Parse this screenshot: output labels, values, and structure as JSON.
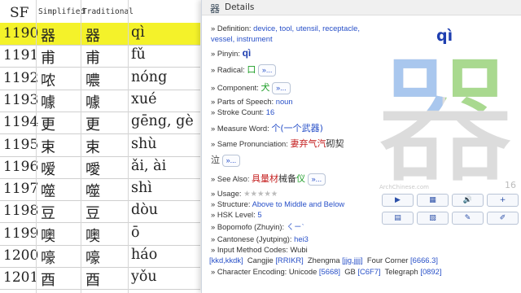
{
  "table": {
    "headers": {
      "sf": "SF",
      "simplified": "Simplified",
      "traditional": "Traditional"
    },
    "rows": [
      {
        "num": "1190",
        "simp": "器",
        "trad": "器",
        "pinyin": "qì"
      },
      {
        "num": "1191",
        "simp": "甫",
        "trad": "甫",
        "pinyin": "fǔ"
      },
      {
        "num": "1192",
        "simp": "哝",
        "trad": "噥",
        "pinyin": "nóng"
      },
      {
        "num": "1193",
        "simp": "噱",
        "trad": "噱",
        "pinyin": "xué"
      },
      {
        "num": "1194",
        "simp": "更",
        "trad": "更",
        "pinyin": "gēng, gè"
      },
      {
        "num": "1195",
        "simp": "束",
        "trad": "束",
        "pinyin": "shù"
      },
      {
        "num": "1196",
        "simp": "嗳",
        "trad": "噯",
        "pinyin": "ǎi, ài"
      },
      {
        "num": "1197",
        "simp": "噬",
        "trad": "噬",
        "pinyin": "shì"
      },
      {
        "num": "1198",
        "simp": "豆",
        "trad": "豆",
        "pinyin": "dòu"
      },
      {
        "num": "1199",
        "simp": "噢",
        "trad": "噢",
        "pinyin": "ō"
      },
      {
        "num": "1200",
        "simp": "嚎",
        "trad": "嚎",
        "pinyin": "háo"
      },
      {
        "num": "1201",
        "simp": "酉",
        "trad": "酉",
        "pinyin": "yǒu"
      }
    ]
  },
  "details": {
    "title": "Details",
    "title_icon": "器",
    "definition_label": "» Definition:",
    "definition_line1": "device, tool, utensil, receptacle,",
    "definition_line2": "vessel, instrument",
    "pinyin_label": "» Pinyin:",
    "pinyin": "qì",
    "radical_label": "» Radical:",
    "radical": "口",
    "component_label": "» Component:",
    "component": "犬",
    "pos_label": "» Parts of Speech:",
    "pos": "noun",
    "stroke_label": "» Stroke Count:",
    "stroke": "16",
    "measure_label": "» Measure Word:",
    "measure": "个(一个武器)",
    "same_label": "» Same Pronunciation:",
    "same_red": "妻弃气汽",
    "same_rest": "砌契",
    "same_line2": "泣",
    "see_label": "» See Also:",
    "see_red": "具量材",
    "see_black": "械备",
    "see_green": "仪",
    "usage_label": "» Usage:",
    "usage_stars": "★★★★★",
    "structure_label": "» Structure:",
    "structure": "Above to Middle and Below",
    "hsk_label": "» HSK Level:",
    "hsk": "5",
    "bopomofo_label": "» Bopomofo (Zhuyin):",
    "bopomofo": "ㄑㄧˋ",
    "cantonese_label": "» Cantonese (Jyutping):",
    "cantonese": "hei3",
    "input_label": "» Input Method Codes:",
    "input_value": "Wubi",
    "wubi_code": "[kkd,kkdk]",
    "cangjie_label": "Cangjie",
    "cangjie_code": "[RRIKR]",
    "zhengma_label": "Zhengma",
    "zhengma_code": "[jjg,jjjj]",
    "fourcorner_label": "Four Corner",
    "fourcorner_code": "[6666.3]",
    "encoding_label": "» Character Encoding:",
    "unicode_label": "Unicode",
    "unicode_code": "[5668]",
    "gb_label": "GB",
    "gb_code": "[C6F7]",
    "telegraph_label": "Telegraph",
    "telegraph_code": "[0892]",
    "more": "»...",
    "big_pinyin": "qì",
    "big_char": "器",
    "watermark": "ArchChinese.com",
    "stroke_badge": "16"
  },
  "buttons": [
    {
      "icon": "play-icon",
      "glyph": "▶"
    },
    {
      "icon": "film-icon",
      "glyph": "▦"
    },
    {
      "icon": "speaker-icon",
      "glyph": "🔊"
    },
    {
      "icon": "add-icon",
      "glyph": "+"
    },
    {
      "icon": "document-icon",
      "glyph": "▤"
    },
    {
      "icon": "image-icon",
      "glyph": "▧"
    },
    {
      "icon": "brush-icon",
      "glyph": "✎"
    },
    {
      "icon": "edit-icon",
      "glyph": "✐"
    }
  ],
  "colors": {
    "highlight": "#f4f22a",
    "link": "#2850c8",
    "red": "#c41e1e",
    "green": "#1e9e28"
  }
}
